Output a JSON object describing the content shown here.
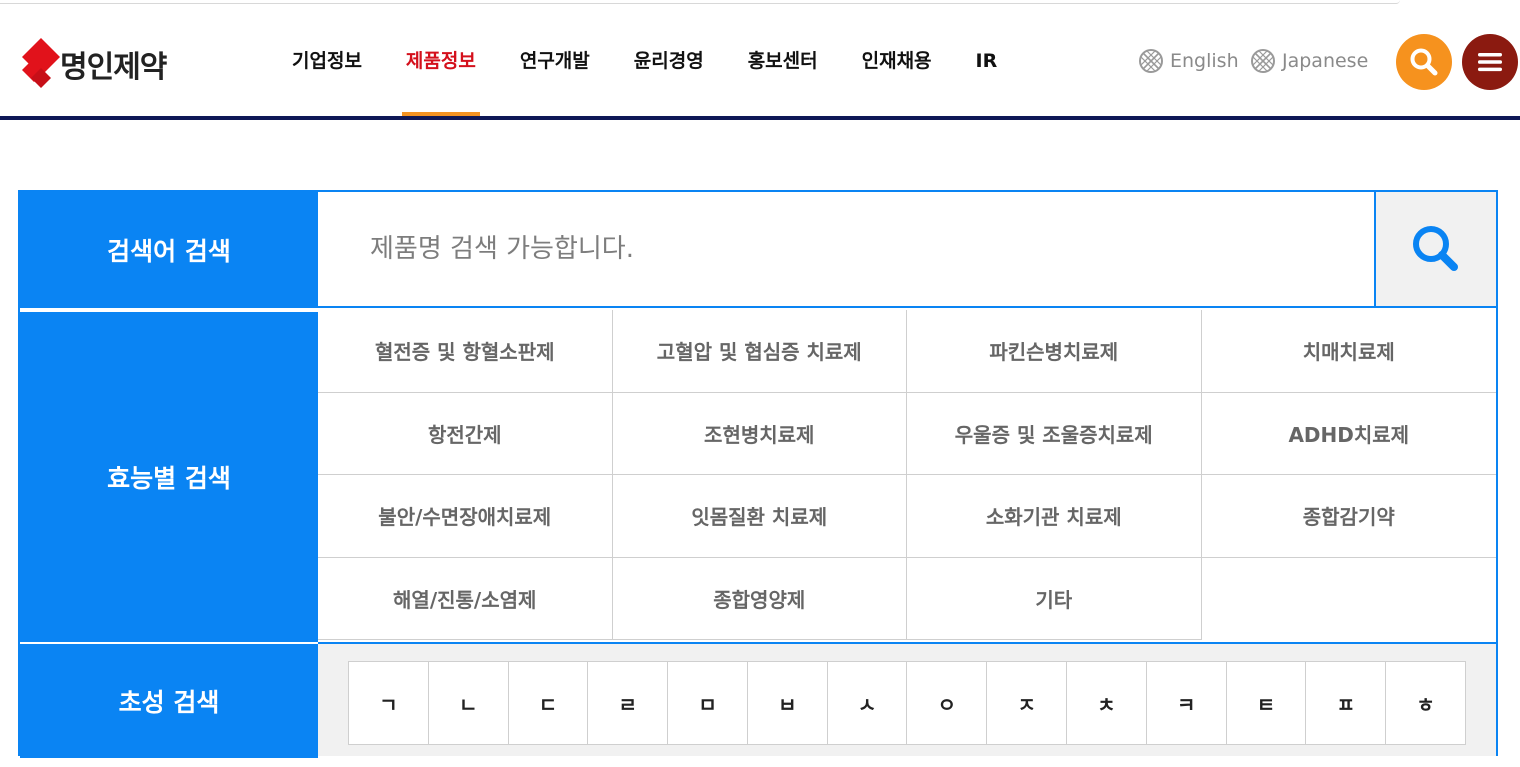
{
  "header": {
    "logo_text": "명인제약",
    "nav": [
      {
        "label": "기업정보",
        "active": false
      },
      {
        "label": "제품정보",
        "active": true
      },
      {
        "label": "연구개발",
        "active": false
      },
      {
        "label": "윤리경영",
        "active": false
      },
      {
        "label": "홍보센터",
        "active": false
      },
      {
        "label": "인재채용",
        "active": false
      },
      {
        "label": "IR",
        "active": false
      }
    ],
    "lang_english": "English",
    "lang_japanese": "Japanese",
    "icons": {
      "search": "search-icon",
      "menu": "hamburger-menu-icon",
      "globe": "globe-icon"
    }
  },
  "colors": {
    "accent_blue": "#0a84f3",
    "active_nav": "#d4101c",
    "orange": "#f6921e",
    "menu_btn": "#8b1a10",
    "header_bar": "#0e1856"
  },
  "search": {
    "keyword_label": "검색어 검색",
    "keyword_placeholder": "제품명 검색 가능합니다.",
    "effect_label": "효능별 검색",
    "effects": [
      "혈전증 및 항혈소판제",
      "고혈압 및 협심증 치료제",
      "파킨슨병치료제",
      "치매치료제",
      "항전간제",
      "조현병치료제",
      "우울증 및 조울증치료제",
      "ADHD치료제",
      "불안/수면장애치료제",
      "잇몸질환 치료제",
      "소화기관 치료제",
      "종합감기약",
      "해열/진통/소염제",
      "종합영양제",
      "기타"
    ],
    "initial_label": "초성 검색",
    "initials": [
      "ㄱ",
      "ㄴ",
      "ㄷ",
      "ㄹ",
      "ㅁ",
      "ㅂ",
      "ㅅ",
      "ㅇ",
      "ㅈ",
      "ㅊ",
      "ㅋ",
      "ㅌ",
      "ㅍ",
      "ㅎ"
    ]
  }
}
